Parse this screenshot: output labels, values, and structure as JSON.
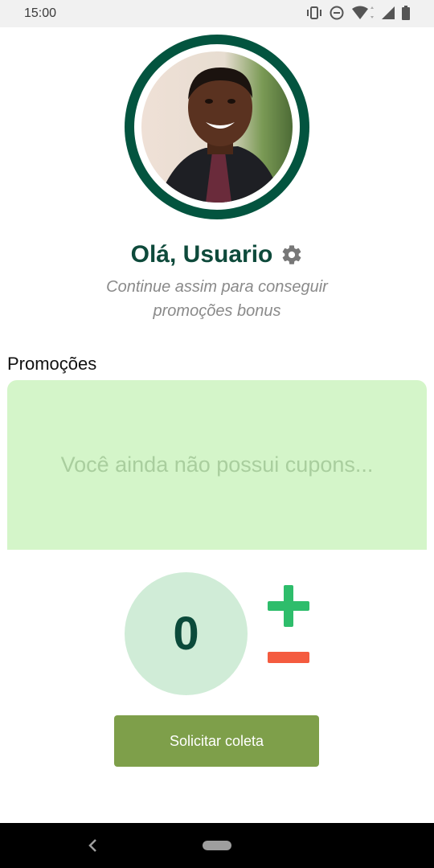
{
  "status_bar": {
    "time": "15:00",
    "icons": [
      "vibrate-icon",
      "dnd-icon",
      "wifi-icon",
      "signal-icon",
      "battery-icon"
    ]
  },
  "profile": {
    "avatar_icon": "profile-photo",
    "greeting": "Olá, Usuario",
    "settings_icon": "gear-icon",
    "subtitle_line1": "Continue assim para conseguir",
    "subtitle_line2": "promoções bonus"
  },
  "promotions": {
    "label": "Promoções",
    "empty_message": "Você ainda não possui cupons..."
  },
  "counter": {
    "value": "0",
    "plus_icon": "plus-icon",
    "minus_icon": "minus-icon"
  },
  "action": {
    "button_label": "Solicitar coleta"
  },
  "colors": {
    "primary_dark": "#03543f",
    "promo_bg": "#d4f5c9",
    "counter_bg": "#d0ecd7",
    "plus": "#2ebd6b",
    "minus": "#f45b3f",
    "button": "#7e9f4a"
  }
}
